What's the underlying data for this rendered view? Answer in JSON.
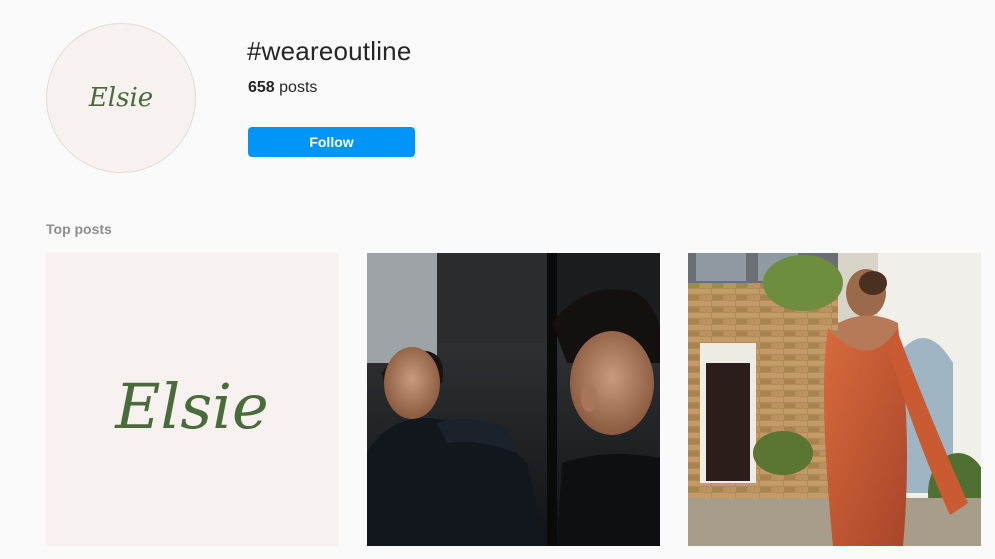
{
  "header": {
    "hashtag": "#weareoutline",
    "post_count": "658",
    "post_count_suffix": " posts",
    "follow_label": "Follow",
    "avatar_logo_text": "Elsie"
  },
  "sections": {
    "top_posts_label": "Top posts"
  },
  "top_posts": [
    {
      "logo_text": "Elsie",
      "description": "Elsie brand logo"
    },
    {
      "description": "Man in black hoodie looking in mirror"
    },
    {
      "description": "Woman in orange backless dress outside brick house"
    }
  ],
  "colors": {
    "accent": "#0095f6",
    "background": "#fafafa",
    "logo_green": "#4a6b3c",
    "logo_bg": "#f7f2ef"
  }
}
